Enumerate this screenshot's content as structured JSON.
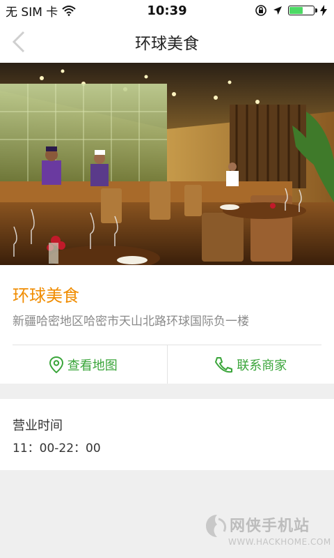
{
  "status_bar": {
    "carrier": "无 SIM 卡",
    "time": "10:39",
    "battery_level": 0.55,
    "icons": [
      "wifi-icon",
      "orientation-lock-icon",
      "location-arrow-icon",
      "battery-icon",
      "charging-bolt-icon"
    ]
  },
  "nav": {
    "title": "环球美食",
    "back_icon": "chevron-left-icon"
  },
  "hero": {
    "description_icon": "restaurant-photo"
  },
  "shop": {
    "name": "环球美食",
    "address": "新疆哈密地区哈密市天山北路环球国际负一楼"
  },
  "actions": {
    "map_label": "查看地图",
    "map_icon": "map-pin-icon",
    "contact_label": "联系商家",
    "contact_icon": "phone-icon"
  },
  "hours": {
    "title": "营业时间",
    "value": "11：00-22：00"
  },
  "watermark": {
    "text": "网侠手机站",
    "url": "WWW.HACKHOME.COM"
  },
  "colors": {
    "accent_orange": "#f08c00",
    "accent_green": "#3aa53a",
    "background": "#efefef"
  }
}
